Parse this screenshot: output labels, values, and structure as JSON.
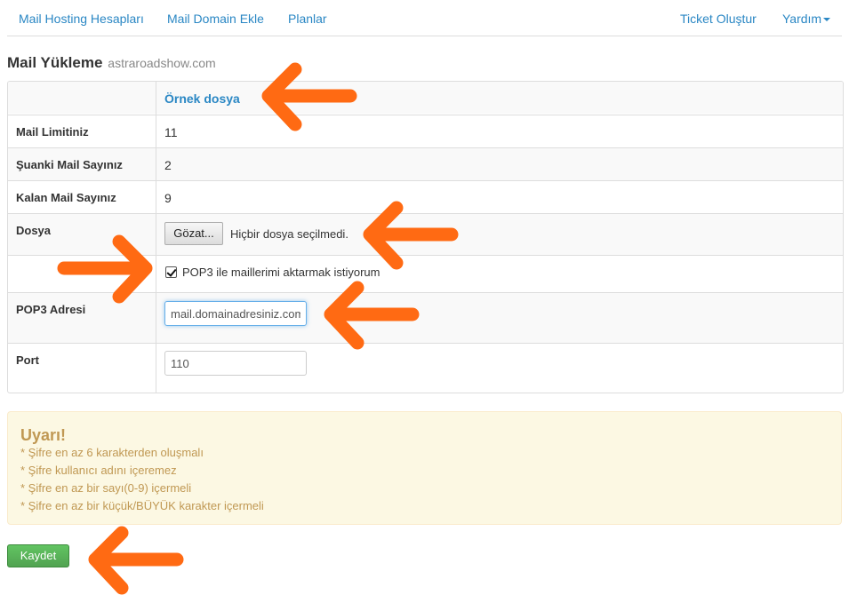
{
  "nav": {
    "left": [
      "Mail Hosting Hesapları",
      "Mail Domain Ekle",
      "Planlar"
    ],
    "ticket": "Ticket Oluştur",
    "help": "Yardım"
  },
  "page": {
    "title": "Mail Yükleme",
    "domain": "astraroadshow.com"
  },
  "table": {
    "sample_link": "Örnek dosya",
    "rows": [
      {
        "label": "Mail Limitiniz",
        "value": "11"
      },
      {
        "label": "Şuanki Mail Sayınız",
        "value": "2"
      },
      {
        "label": "Kalan Mail Sayınız",
        "value": "9"
      }
    ],
    "file": {
      "label": "Dosya",
      "button": "Gözat...",
      "status": "Hiçbir dosya seçilmedi."
    },
    "pop3_checkbox": {
      "label": "POP3 ile maillerimi aktarmak istiyorum",
      "checked": true
    },
    "pop3_address": {
      "label": "POP3 Adresi",
      "value": "mail.domainadresiniz.com"
    },
    "port": {
      "label": "Port",
      "value": "110"
    }
  },
  "alert": {
    "title": "Uyarı!",
    "lines": [
      "* Şifre en az 6 karakterden oluşmalı",
      "* Şifre kullanıcı adını içeremez",
      "* Şifre en az bir sayı(0-9) içermeli",
      "* Şifre en az bir küçük/BÜYÜK karakter içermeli"
    ]
  },
  "save_button": "Kaydet",
  "colors": {
    "link": "#2a87c4",
    "arrow": "#ff6a13",
    "alert_bg": "#fcf8e3",
    "alert_text": "#c09853",
    "save": "#5cb85c"
  },
  "annotations": [
    "arrow-icon",
    "arrow-icon",
    "arrow-icon",
    "arrow-icon",
    "arrow-icon"
  ]
}
